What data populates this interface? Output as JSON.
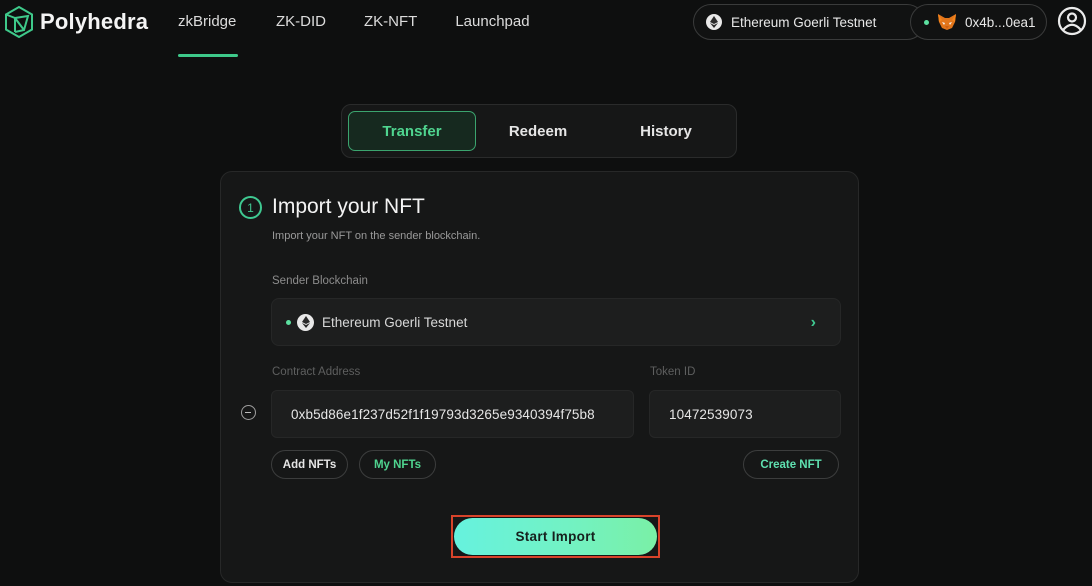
{
  "brand": {
    "name": "Polyhedra",
    "accent": "#3ec98a"
  },
  "nav": {
    "items": [
      {
        "label": "zkBridge",
        "active": true
      },
      {
        "label": "ZK-DID",
        "active": false
      },
      {
        "label": "ZK-NFT",
        "active": false
      },
      {
        "label": "Launchpad",
        "active": false
      }
    ]
  },
  "header": {
    "network": {
      "icon": "ethereum-icon",
      "label": "Ethereum Goerli Testnet"
    },
    "wallet": {
      "status": "connected",
      "icon": "metamask-fox-icon",
      "address": "0x4b...0ea1"
    },
    "account_icon": "user-circle-icon"
  },
  "tabs": [
    {
      "label": "Transfer",
      "active": true
    },
    {
      "label": "Redeem",
      "active": false
    },
    {
      "label": "History",
      "active": false
    }
  ],
  "card": {
    "step": "1",
    "title": "Import your NFT",
    "subtitle": "Import your NFT on the sender blockchain.",
    "sender_blockchain": {
      "label": "Sender Blockchain",
      "value": "Ethereum Goerli Testnet",
      "icon": "ethereum-icon"
    },
    "contract_address": {
      "label": "Contract Address",
      "value": "0xb5d86e1f237d52f1f19793d3265e9340394f75b8"
    },
    "token_id": {
      "label": "Token ID",
      "value": "10472539073"
    },
    "buttons": {
      "add_nfts": "Add NFTs",
      "my_nfts": "My NFTs",
      "create_nft": "Create NFT",
      "start_import": "Start Import"
    }
  },
  "colors": {
    "background": "#0e0f0f",
    "card": "#161717",
    "accent_green": "#4fd48f",
    "highlight_border": "#d8432a",
    "button_gradient_start": "#66f2de",
    "button_gradient_end": "#7af0a6"
  }
}
